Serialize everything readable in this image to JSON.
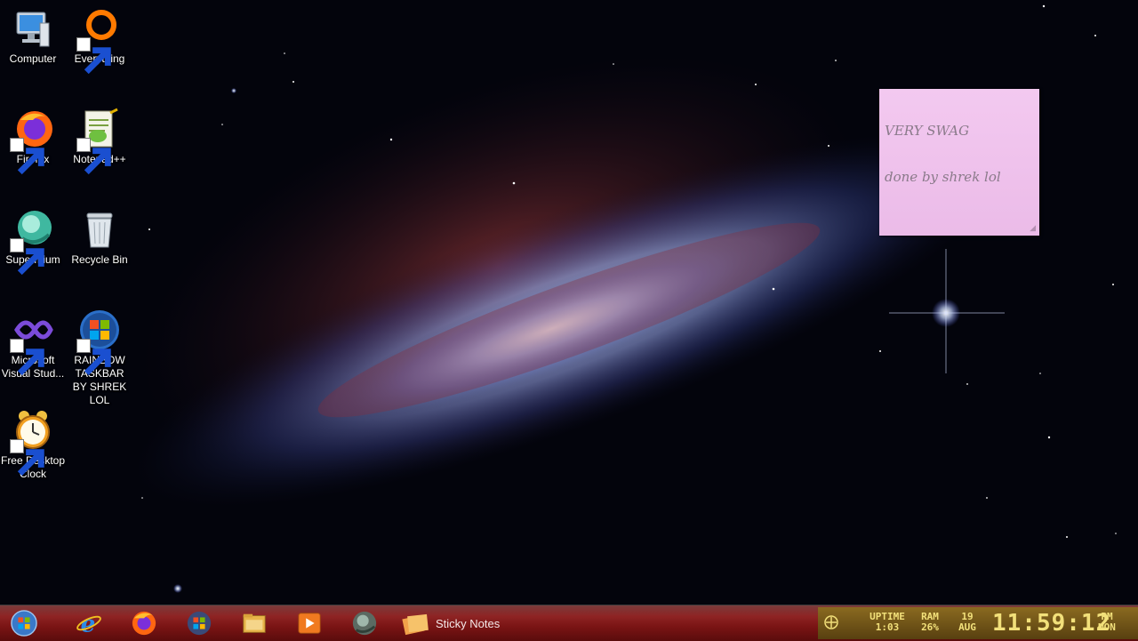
{
  "desktop": {
    "icons": [
      {
        "label": "Computer",
        "icon": "computer-icon"
      },
      {
        "label": "Everything",
        "icon": "everything-icon"
      },
      {
        "label": "Firefox",
        "icon": "firefox-icon"
      },
      {
        "label": "Notepad++",
        "icon": "notepad-plus-plus-icon"
      },
      {
        "label": "Supermium",
        "icon": "supermium-icon"
      },
      {
        "label": "Recycle Bin",
        "icon": "recycle-bin-icon"
      },
      {
        "label": "Microsoft Visual Stud...",
        "icon": "visual-studio-icon"
      },
      {
        "label": "RAINBOW TASKBAR BY SHREK LOL",
        "icon": "windows-logo-icon"
      },
      {
        "label": "Free Desktop Clock",
        "icon": "alarm-clock-icon"
      }
    ]
  },
  "sticky_note": {
    "line1": "VERY SWAG",
    "line2": "done by shrek lol",
    "color": "#f0c3ee"
  },
  "taskbar": {
    "start": "start-orb-icon",
    "pinned": [
      "internet-explorer-icon",
      "firefox-icon",
      "windows-media-center-icon",
      "file-explorer-icon",
      "media-player-icon",
      "supermium-icon"
    ],
    "active_window_label": "Sticky Notes",
    "color": "#8e2424"
  },
  "tray": {
    "uptime_label": "UPTIME",
    "uptime_value": "1:03",
    "ram_label": "RAM",
    "ram_value": "26%",
    "date_day": "19",
    "date_month": "AUG",
    "time": "11:59:12",
    "ampm": "PM",
    "weekday": "MON"
  }
}
